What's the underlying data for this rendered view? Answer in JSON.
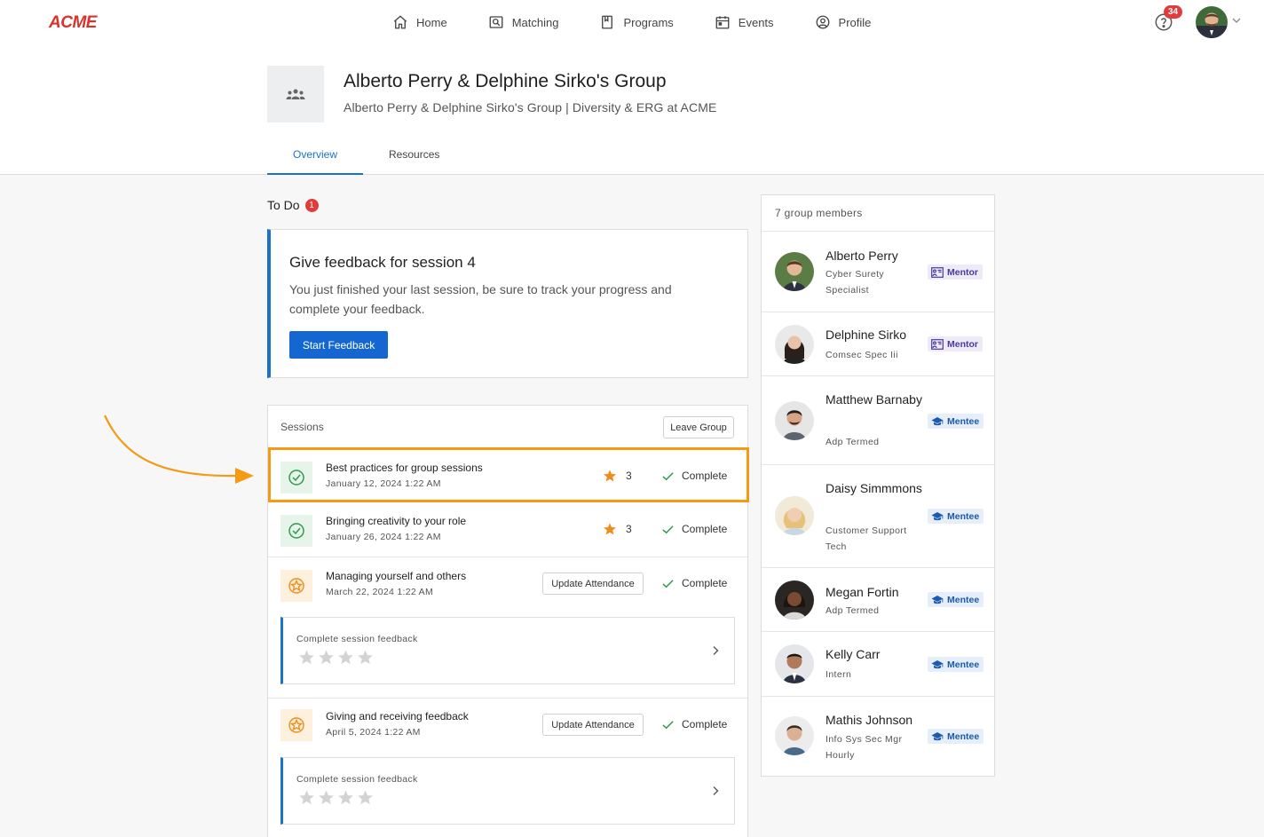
{
  "header": {
    "logo": "ACME",
    "nav": [
      {
        "label": "Home",
        "icon": "home-icon"
      },
      {
        "label": "Matching",
        "icon": "matching-icon"
      },
      {
        "label": "Programs",
        "icon": "programs-icon"
      },
      {
        "label": "Events",
        "icon": "calendar-icon"
      },
      {
        "label": "Profile",
        "icon": "profile-icon"
      }
    ],
    "notification_count": "34"
  },
  "group": {
    "title": "Alberto Perry & Delphine Sirko's Group",
    "subtitle": "Alberto Perry & Delphine Sirko's Group | Diversity & ERG at ACME"
  },
  "tabs": [
    {
      "label": "Overview",
      "active": true
    },
    {
      "label": "Resources",
      "active": false
    }
  ],
  "todo": {
    "heading": "To Do",
    "count": "1",
    "card_title": "Give feedback for session 4",
    "card_desc": "You just finished your last session, be sure to track your progress and complete your feedback.",
    "button": "Start Feedback"
  },
  "sessions": {
    "heading": "Sessions",
    "leave_button": "Leave Group",
    "items": [
      {
        "name": "Best practices for group sessions",
        "date": "January 12, 2024 1:22 AM",
        "rating": "3",
        "status": "Complete",
        "state": "done"
      },
      {
        "name": "Bringing creativity to your role",
        "date": "January 26, 2024 1:22 AM",
        "rating": "3",
        "status": "Complete",
        "state": "done"
      },
      {
        "name": "Managing yourself and others",
        "date": "March 22, 2024 1:22 AM",
        "attendance_button": "Update Attendance",
        "status": "Complete",
        "state": "pending",
        "feedback_label": "Complete session feedback"
      },
      {
        "name": "Giving and receiving feedback",
        "date": "April 5, 2024 1:22 AM",
        "attendance_button": "Update Attendance",
        "status": "Complete",
        "state": "pending",
        "feedback_label": "Complete session feedback"
      }
    ]
  },
  "members": {
    "heading": "7 group members",
    "items": [
      {
        "name": "Alberto Perry",
        "role": "Cyber Surety Specialist",
        "tag": "Mentor"
      },
      {
        "name": "Delphine Sirko",
        "role": "Comsec Spec Iii",
        "tag": "Mentor"
      },
      {
        "name": "Matthew Barnaby",
        "role": "Adp Termed",
        "tag": "Mentee"
      },
      {
        "name": "Daisy Simmmons",
        "role": "Customer Support Tech",
        "tag": "Mentee"
      },
      {
        "name": "Megan Fortin",
        "role": "Adp Termed",
        "tag": "Mentee"
      },
      {
        "name": "Kelly Carr",
        "role": "Intern",
        "tag": "Mentee"
      },
      {
        "name": "Mathis Johnson",
        "role": "Info Sys Sec Mgr Hourly",
        "tag": "Mentee"
      }
    ]
  },
  "colors": {
    "accent": "#1a73c8",
    "highlight": "#f49a14",
    "badge": "#e23b3b",
    "star": "#f08c1a",
    "complete_green": "#2e9a4c"
  }
}
